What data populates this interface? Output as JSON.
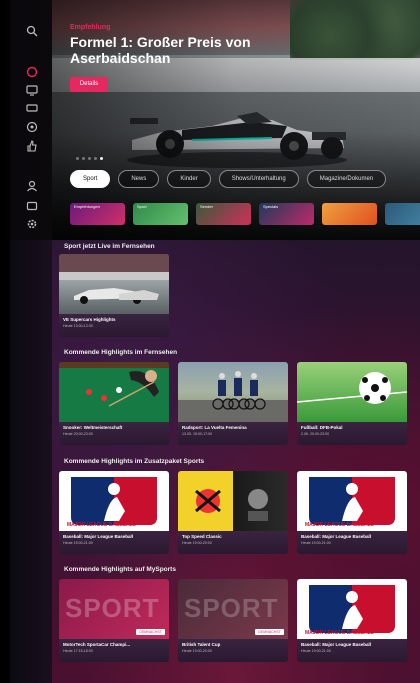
{
  "hero": {
    "subtitle": "Empfehlung",
    "title": "Formel 1: Großer Preis von Aserbaidschan",
    "button_label": "Details"
  },
  "chips": [
    "Sport",
    "News",
    "Kinder",
    "Shows/Unterhaltung",
    "Magazine/Dokumen"
  ],
  "thumbs": [
    {
      "label": "Empfehlungen",
      "color": "#b0267a"
    },
    {
      "label": "Sport",
      "color": "#3b9a55"
    },
    {
      "label": "Sender",
      "color": "#4a6a44"
    },
    {
      "label": "Specials",
      "color": "#2d4f6e"
    },
    {
      "label": "",
      "color": "#f07830"
    },
    {
      "label": "",
      "color": "#3a6a8a"
    }
  ],
  "sections": [
    {
      "title": "Sport jetzt Live im Fernsehen",
      "cards": [
        {
          "title": "VE Supercars Highlights",
          "sub": "Heute 13:00-13:30",
          "badge": ""
        }
      ]
    },
    {
      "title": "Kommende Highlights im Fernsehen",
      "cards": [
        {
          "title": "Snooker: Weltmeisterschaft",
          "sub": "Heute 20:00-23:00",
          "badge": ""
        },
        {
          "title": "Radsport: La Vuelta Femenina",
          "sub": "13.05. 15:00-17:00",
          "badge": ""
        },
        {
          "title": "Fußball: DFB-Pokal",
          "sub": "2.06. 20:00-23:00",
          "badge": ""
        }
      ]
    },
    {
      "title": "Kommende Highlights im Zusatzpaket Sports",
      "cards": [
        {
          "title": "Baseball: Major League Baseball",
          "sub": "Heute 19:00-21:00",
          "badge": ""
        },
        {
          "title": "Top Speed Classic",
          "sub": "Heute 19:00-20:00",
          "badge": ""
        },
        {
          "title": "Baseball: Major League Baseball",
          "sub": "Heute 19:00-21:00",
          "badge": ""
        }
      ]
    },
    {
      "title": "Kommende Highlights auf MySports",
      "cards": [
        {
          "title": "MotorTech SportaCar Champi...",
          "sub": "Heute 17:15-18:00",
          "badge": "DEMNÄCHST"
        },
        {
          "title": "British Talent Cup",
          "sub": "Heute 19:00-20:00",
          "badge": "DEMNÄCHST"
        },
        {
          "title": "Baseball: Major League Baseball",
          "sub": "Heute 19:00-21:00",
          "badge": ""
        }
      ]
    }
  ],
  "mlb_text": "MAJOR LEAGUE BASEBALL",
  "sport_text": "SPORT",
  "colors": {
    "accent": "#e5285f"
  }
}
